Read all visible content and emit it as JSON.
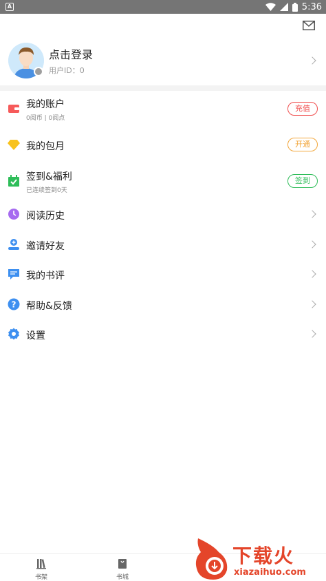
{
  "status_bar": {
    "time": "5:36"
  },
  "profile": {
    "title": "点击登录",
    "user_id": "用户ID：0"
  },
  "menu": [
    {
      "label": "我的账户",
      "sub": "0阅币 | 0阅点",
      "action": "充值",
      "action_color": "#f04d4d",
      "icon": "wallet-icon",
      "icon_color": "#f65a5a"
    },
    {
      "label": "我的包月",
      "action": "开通",
      "action_color": "#f2a63a",
      "icon": "diamond-icon",
      "icon_color": "#f8c21c"
    },
    {
      "label": "签到&福利",
      "sub": "已连续签到0天",
      "action": "签到",
      "action_color": "#2ebd59",
      "icon": "calendar-check-icon",
      "icon_color": "#2ebd59"
    },
    {
      "label": "阅读历史",
      "icon": "clock-icon",
      "icon_color": "#a66bf0"
    },
    {
      "label": "邀请好友",
      "icon": "add-friend-icon",
      "icon_color": "#3d8ff0"
    },
    {
      "label": "我的书评",
      "icon": "comment-icon",
      "icon_color": "#3d8ff0"
    },
    {
      "label": "帮助&反馈",
      "icon": "help-icon",
      "icon_color": "#3d8ff0"
    },
    {
      "label": "设置",
      "icon": "settings-icon",
      "icon_color": "#3d8ff0"
    }
  ],
  "bottom_nav": [
    {
      "label": "书架",
      "icon": "bookshelf-icon"
    },
    {
      "label": "书城",
      "icon": "bookstore-icon"
    }
  ],
  "watermark": {
    "title": "下载火",
    "url": "xiazaihuo.com"
  }
}
